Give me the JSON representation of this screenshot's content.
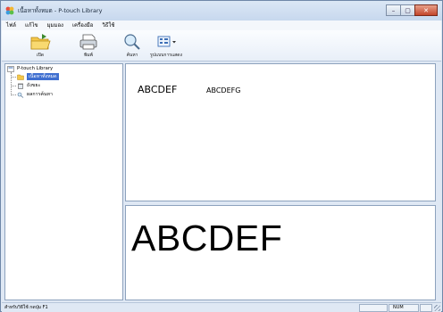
{
  "window": {
    "title": "เนื้อหาทั้งหมด - P-touch Library",
    "buttons": {
      "minimize": "–",
      "maximize": "▢",
      "close": "✕"
    }
  },
  "menubar": {
    "items": [
      "ไฟล์",
      "แก้ไข",
      "มุมมอง",
      "เครื่องมือ",
      "วิธีใช้"
    ]
  },
  "toolbar": {
    "open_label": "เปิด",
    "print_label": "พิมพ์",
    "search_label": "ค้นหา",
    "view_style_label": "รูปแบบการแสดง"
  },
  "tree": {
    "root": "P-touch Library",
    "children": [
      "เนื้อหาทั้งหมด",
      "ถังขยะ",
      "ผลการค้นหา"
    ],
    "selected_index": 0
  },
  "labels": {
    "items": [
      "ABCDEF",
      "ABCDEFG"
    ]
  },
  "preview": {
    "text": "ABCDEF"
  },
  "statusbar": {
    "help_text": "สำหรับวิธีใช้ กดปุ่ม F1",
    "num_indicator": "NUM"
  },
  "colors": {
    "selection": "#3f6fd0",
    "close_button": "#c3452b",
    "frame": "#dfe8f4"
  },
  "icons": [
    "app-icon",
    "open-folder-icon",
    "print-icon",
    "search-icon",
    "view-style-icon",
    "library-icon",
    "folder-icon",
    "trash-icon",
    "search-results-icon"
  ]
}
